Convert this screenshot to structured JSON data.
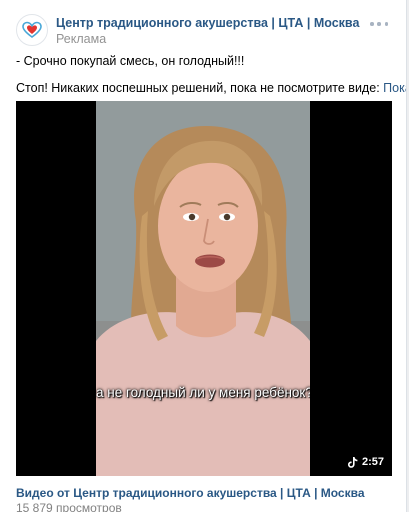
{
  "post": {
    "author": "Центр традиционного акушерства | ЦТА | Москва",
    "ad_label": "Реклама",
    "text_line1": "- Срочно покупай смесь, он голодный!!!",
    "text_line2": "Стоп! Никаких поспешных решений, пока не посмотрите виде",
    "show_more": "Показать ещё"
  },
  "video": {
    "subtitle": "а не голодный ли у меня ребёнок?",
    "duration": "2:57",
    "title": "Видео от Центр традиционного акушерства | ЦТА | Москва",
    "views": "15 879 просмотров"
  },
  "icons": {
    "avatar": "heart-logo-icon",
    "more": "more-dots-icon",
    "tiktok": "tiktok-icon"
  },
  "colors": {
    "link": "#2a5885",
    "muted": "#939393",
    "logo_red": "#e3342f",
    "logo_blue": "#4aa8d8"
  }
}
